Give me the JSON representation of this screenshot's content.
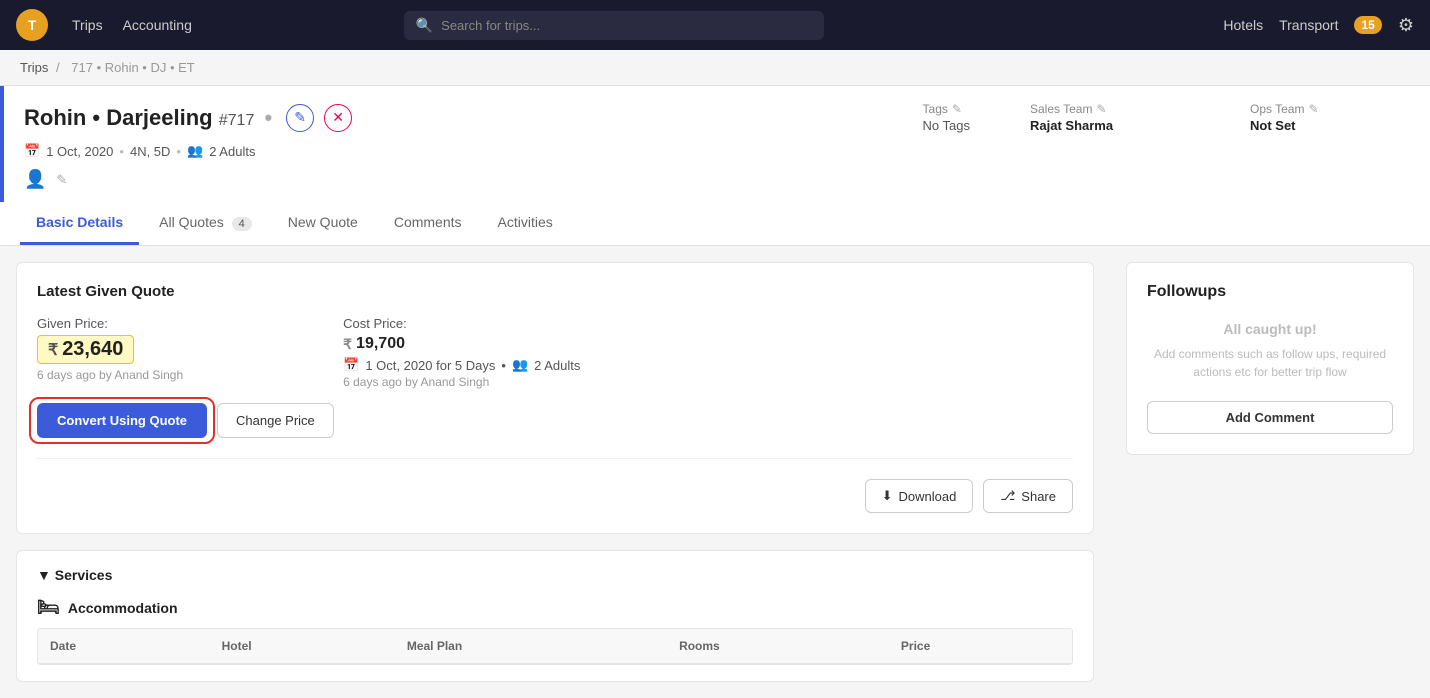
{
  "app": {
    "logo": "T",
    "nav_links": [
      "Trips",
      "Accounting"
    ],
    "search_placeholder": "Search for trips...",
    "nav_right": [
      "Hotels",
      "Transport"
    ],
    "notifications_count": "15"
  },
  "breadcrumb": {
    "items": [
      "Trips",
      "717 • Rohin • DJ • ET"
    ]
  },
  "trip": {
    "title": "Rohin • Darjeeling",
    "id": "#717",
    "dot": "•",
    "date": "1 Oct, 2020",
    "duration": "4N, 5D",
    "adults": "2 Adults",
    "tags_label": "Tags",
    "tags_edit": "✎",
    "tags_value": "No Tags",
    "sales_team_label": "Sales Team",
    "sales_team_edit": "✎",
    "sales_team_value": "Rajat Sharma",
    "ops_team_label": "Ops Team",
    "ops_team_edit": "✎",
    "ops_team_value": "Not Set"
  },
  "tabs": {
    "items": [
      {
        "label": "Basic Details",
        "active": true,
        "badge": null
      },
      {
        "label": "All Quotes",
        "active": false,
        "badge": "4"
      },
      {
        "label": "New Quote",
        "active": false,
        "badge": null
      },
      {
        "label": "Comments",
        "active": false,
        "badge": null
      },
      {
        "label": "Activities",
        "active": false,
        "badge": null
      }
    ]
  },
  "quote": {
    "section_title": "Latest Given Quote",
    "given_price_label": "Given Price:",
    "given_price_value": "23,640",
    "given_price_ago": "6 days ago by Anand Singh",
    "cost_price_label": "Cost Price:",
    "cost_price_value": "19,700",
    "cost_price_date": "1 Oct, 2020 for 5 Days",
    "cost_price_adults": "2 Adults",
    "cost_price_ago": "6 days ago by Anand Singh",
    "convert_btn": "Convert Using Quote",
    "change_price_btn": "Change Price",
    "download_btn": "Download",
    "share_btn": "Share"
  },
  "services": {
    "title": "▼ Services",
    "accommodation_label": "Accommodation",
    "table_headers": [
      "Date",
      "Hotel",
      "Meal Plan",
      "Rooms",
      "Price"
    ]
  },
  "followups": {
    "title": "Followups",
    "caught_up": "All caught up!",
    "description": "Add comments such as follow ups, required actions etc for better trip flow",
    "add_comment_btn": "Add Comment"
  }
}
